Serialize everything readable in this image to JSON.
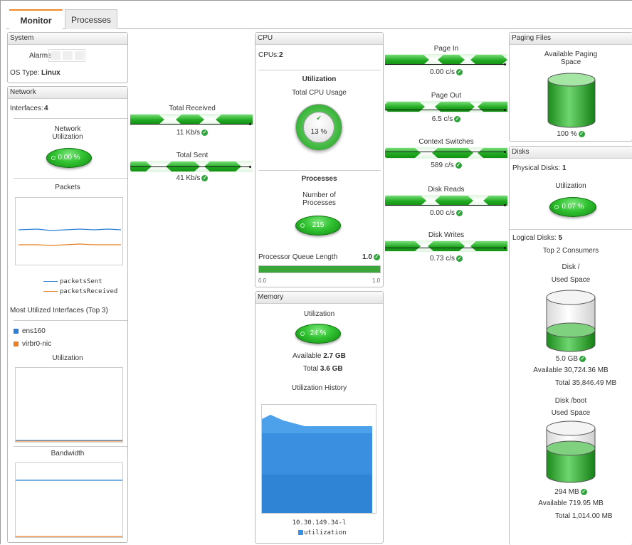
{
  "tabs": {
    "monitor": "Monitor",
    "processes": "Processes"
  },
  "system": {
    "title": "System",
    "alarms_label": "Alarms",
    "os_label": "OS Type:",
    "os_value": "Linux"
  },
  "network": {
    "title": "Network",
    "interfaces_label": "Interfaces:",
    "interfaces_value": "4",
    "util_label_1": "Network",
    "util_label_2": "Utilization",
    "util_value": "0.00 %",
    "packets_label": "Packets",
    "legend": [
      "packetsSent",
      "packetsReceived"
    ],
    "top_label": "Most Utilized Interfaces (Top 3)",
    "ifaces": [
      "ens160",
      "virbr0-nic"
    ],
    "utilization_label": "Utilization",
    "bandwidth_label": "Bandwidth"
  },
  "traffic": {
    "received_label": "Total Received",
    "received_value": "11 Kb/s",
    "sent_label": "Total Sent",
    "sent_value": "41 Kb/s"
  },
  "cpu": {
    "title": "CPU",
    "cpus_label": "CPUs:",
    "cpus_value": "2",
    "util_heading": "Utilization",
    "total_label": "Total CPU Usage",
    "total_value": "13 %",
    "proc_heading": "Processes",
    "num_label_1": "Number of",
    "num_label_2": "Processes",
    "num_value": "215",
    "queue_label": "Processor Queue Length",
    "queue_value": "1.0",
    "queue_min": "0.0",
    "queue_max": "1.0",
    "queue_level": 1.0
  },
  "memory": {
    "title": "Memory",
    "util_heading": "Utilization",
    "util_value": "24 %",
    "available_label": "Available",
    "available_value": "2.7 GB",
    "total_label": "Total",
    "total_value": "3.6 GB",
    "history_label": "Utilization History",
    "host": "10.30.149.34-l",
    "legend": "utilization"
  },
  "rates": [
    {
      "label": "Page In",
      "value": "0.00 c/s"
    },
    {
      "label": "Page Out",
      "value": "6.5 c/s"
    },
    {
      "label": "Context Switches",
      "value": "589 c/s"
    },
    {
      "label": "Disk Reads",
      "value": "0.00 c/s"
    },
    {
      "label": "Disk Writes",
      "value": "0.73 c/s"
    }
  ],
  "paging": {
    "title": "Paging Files",
    "label_1": "Available Paging",
    "label_2": "Space",
    "value": "100 %",
    "level": 1.0
  },
  "disks": {
    "title": "Disks",
    "physical_label": "Physical Disks:",
    "physical_value": "1",
    "util_label": "Utilization",
    "util_value": "0.07 %",
    "logical_label": "Logical Disks:",
    "logical_value": "5",
    "top_label": "Top 2 Consumers",
    "d1": {
      "name": "Disk /",
      "sub": "Used Space",
      "value": "5.0 GB",
      "available": "Available 30,724.36 MB",
      "total": "Total 35,846.49 MB"
    },
    "d2": {
      "name": "Disk /boot",
      "sub": "Used Space",
      "value": "294 MB",
      "available": "Available 719.95 MB",
      "total": "Total 1,014.00 MB"
    }
  },
  "colors": {
    "sent": "#2a7fd4",
    "received": "#e67e22",
    "ok": "#2ea43a",
    "bar": "#3aa63a",
    "area": "#3a8fe0"
  }
}
